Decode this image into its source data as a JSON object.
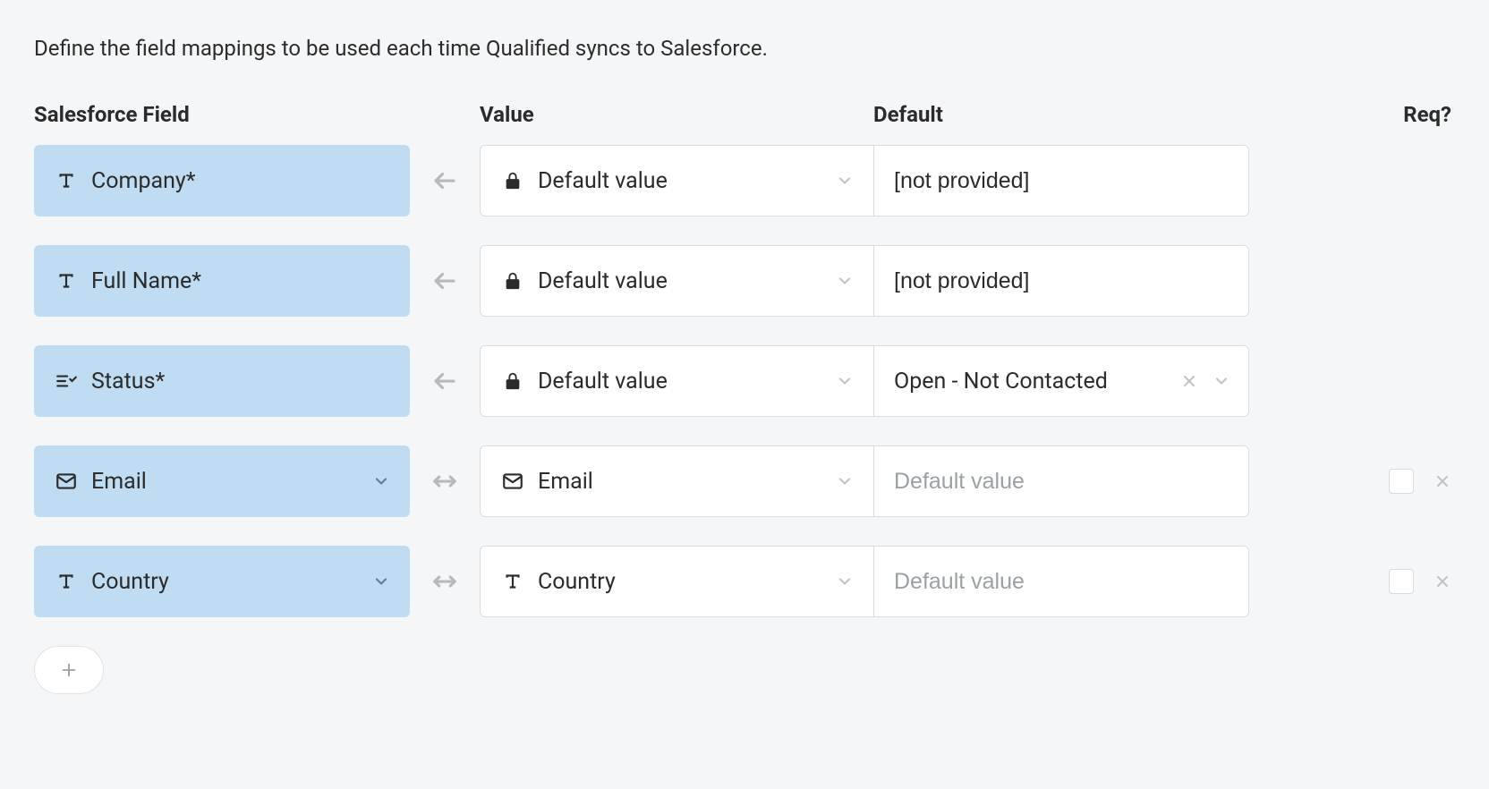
{
  "intro": "Define the field mappings to be used each time Qualified syncs to Salesforce.",
  "headers": {
    "sf": "Salesforce Field",
    "value": "Value",
    "default": "Default",
    "req": "Req?"
  },
  "labels": {
    "default_value": "Default value",
    "email": "Email",
    "country": "Country"
  },
  "placeholders": {
    "default_value": "Default value"
  },
  "rows": [
    {
      "sf_label": "Company*",
      "sf_icon": "text",
      "sf_dropdown": false,
      "arrow": "left",
      "value_icon": "lock",
      "value_label_key": "default_value",
      "default_type": "text",
      "default_value": "[not provided]",
      "has_tail": false
    },
    {
      "sf_label": "Full Name*",
      "sf_icon": "text",
      "sf_dropdown": false,
      "arrow": "left",
      "value_icon": "lock",
      "value_label_key": "default_value",
      "default_type": "text",
      "default_value": "[not provided]",
      "has_tail": false
    },
    {
      "sf_label": "Status*",
      "sf_icon": "picklist",
      "sf_dropdown": false,
      "arrow": "left",
      "value_icon": "lock",
      "value_label_key": "default_value",
      "default_type": "select",
      "default_value": "Open - Not Contacted",
      "has_tail": false
    },
    {
      "sf_label": "Email",
      "sf_icon": "mail",
      "sf_dropdown": true,
      "arrow": "both",
      "value_icon": "mail",
      "value_label_key": "email",
      "default_type": "text",
      "default_value": "",
      "has_tail": true
    },
    {
      "sf_label": "Country",
      "sf_icon": "text",
      "sf_dropdown": true,
      "arrow": "both",
      "value_icon": "text",
      "value_label_key": "country",
      "default_type": "text",
      "default_value": "",
      "has_tail": true
    }
  ]
}
